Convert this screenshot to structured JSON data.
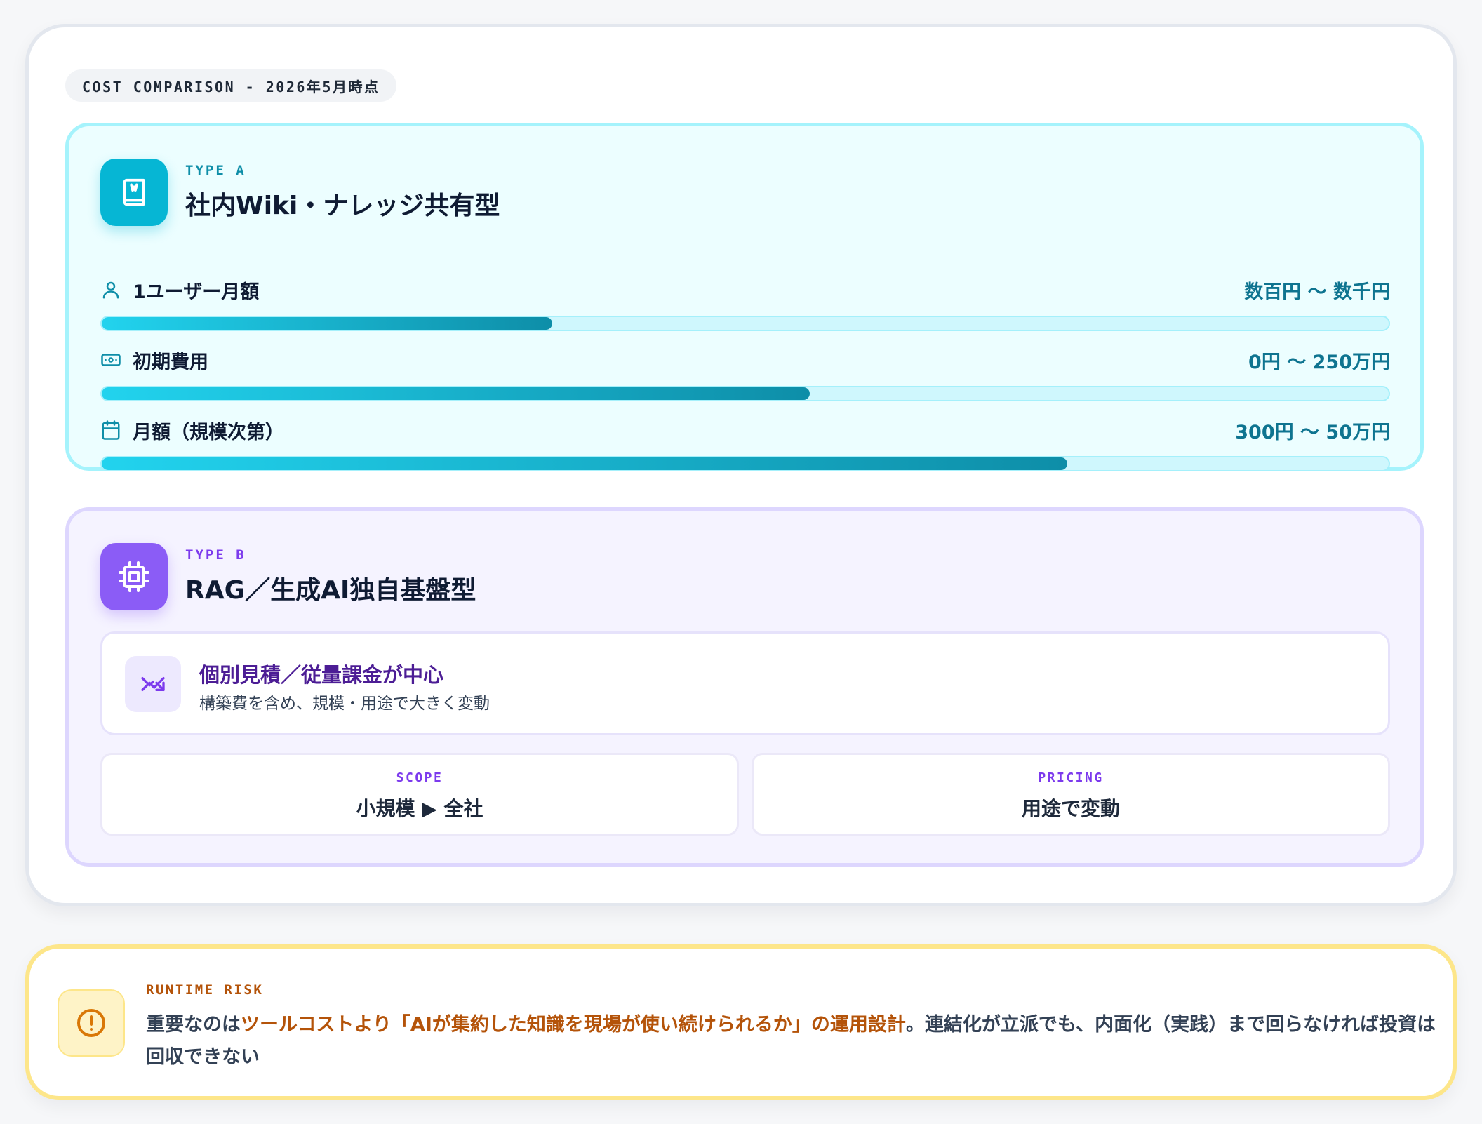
{
  "header": {
    "pill_text": "COST COMPARISON - 2026年5月時点"
  },
  "type_a": {
    "label": "TYPE A",
    "title": "社内Wiki・ナレッジ共有型",
    "icon": "book-icon",
    "accent": "#06b6d4",
    "rows": [
      {
        "icon": "user-icon",
        "label": "1ユーザー月額",
        "value": "数百円 ～ 数千円",
        "level": 0.35
      },
      {
        "icon": "banknote-icon",
        "label": "初期費用",
        "value": "0円 ～ 250万円",
        "level": 0.55
      },
      {
        "icon": "calendar-icon",
        "label": "月額（規模次第）",
        "value": "300円 ～ 50万円",
        "level": 0.75
      }
    ]
  },
  "type_b": {
    "label": "TYPE B",
    "title": "RAG／生成AI独自基盤型",
    "icon": "chip-icon",
    "accent": "#8b5cf6",
    "info": {
      "icon": "trend-icon",
      "title": "個別見積／従量課金が中心",
      "subtitle": "構築費を含め、規模・用途で大きく変動"
    },
    "scope": {
      "label": "SCOPE",
      "value": "小規模 ▶ 全社"
    },
    "pricing": {
      "label": "PRICING",
      "value": "用途で変動"
    }
  },
  "risk": {
    "label": "RUNTIME RISK",
    "icon": "alert-circle-icon",
    "text_pre": "重要なのは",
    "text_highlight": "ツールコストより「AIが集約した知識を現場が使い続けられるか」の運用設計",
    "text_post": "。連結化が立派でも、内面化（実践）まで回らなければ投資は回収できない",
    "accent": "#b45309"
  }
}
